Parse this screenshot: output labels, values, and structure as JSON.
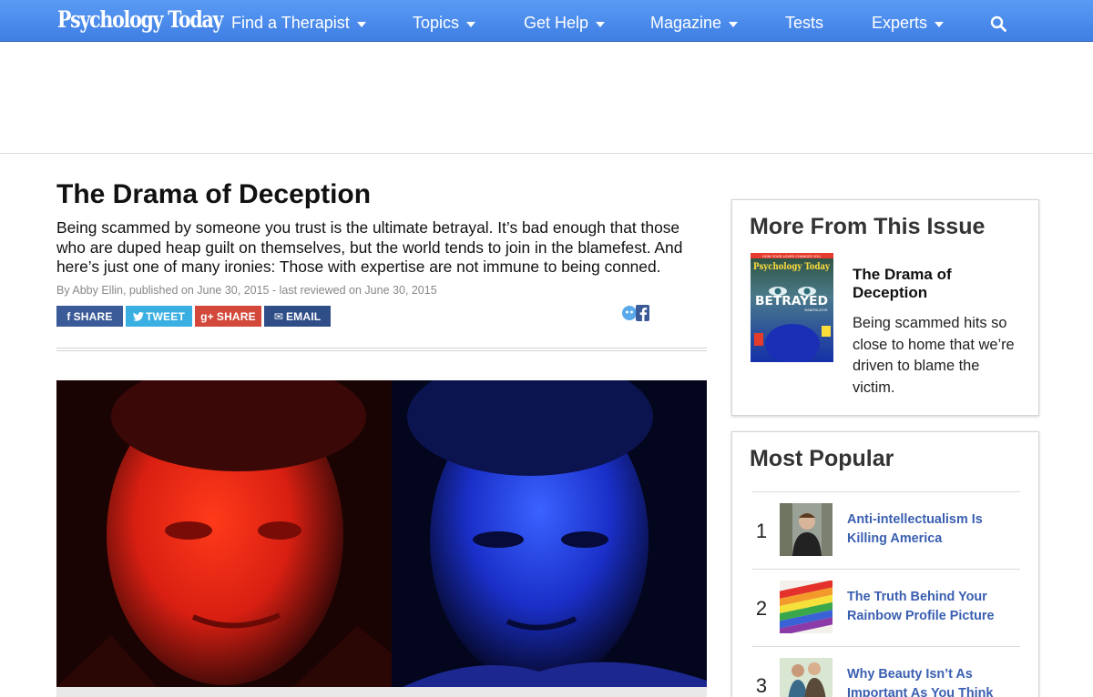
{
  "nav": {
    "logo": "Psychology Today",
    "items": [
      {
        "label": "Find a Therapist",
        "has_caret": true
      },
      {
        "label": "Topics",
        "has_caret": true
      },
      {
        "label": "Get Help",
        "has_caret": true
      },
      {
        "label": "Magazine",
        "has_caret": true
      },
      {
        "label": "Tests",
        "has_caret": false
      },
      {
        "label": "Experts",
        "has_caret": true
      }
    ],
    "search_icon": "search-icon",
    "bar_color": "#4a8af0"
  },
  "article": {
    "title": "The Drama of Deception",
    "dek": "Being scammed by someone you trust is the ultimate betrayal. It’s bad enough that those who are duped heap guilt on themselves, but the world tends to join in the blamefest. And here’s just one of many ironies: Those with expertise are not immune to being conned.",
    "byline": "By Abby Ellin, published on June 30, 2015 - last reviewed on June 30, 2015",
    "share": {
      "facebook": {
        "icon": "f",
        "label": "SHARE",
        "color": "#3b5a98"
      },
      "twitter": {
        "icon": "▾",
        "label": "TWEET",
        "color": "#3ab0e2"
      },
      "googleplus": {
        "icon": "g+",
        "label": "SHARE",
        "color": "#d2493b"
      },
      "email": {
        "icon": "✉",
        "label": "EMAIL",
        "color": "#2f4e88"
      }
    }
  },
  "sidebar": {
    "issue": {
      "heading": "More From This Issue",
      "cover": {
        "tagline": "HOW YOUR LOVER CHANGES YOU",
        "masthead": "Psychology Today",
        "headline": "BETRAYED",
        "subline": "MANIPULATOR"
      },
      "title": "The Drama of Deception",
      "desc": "Being scammed hits so close to home that we’re driven to blame the victim."
    },
    "popular": {
      "heading": "Most Popular",
      "items": [
        {
          "rank": "1",
          "title": "Anti-intellectualism Is Killing America"
        },
        {
          "rank": "2",
          "title": "The Truth Behind Your Rainbow Profile Picture"
        },
        {
          "rank": "3",
          "title": "Why Beauty Isn’t As Important As You Think"
        }
      ]
    }
  }
}
